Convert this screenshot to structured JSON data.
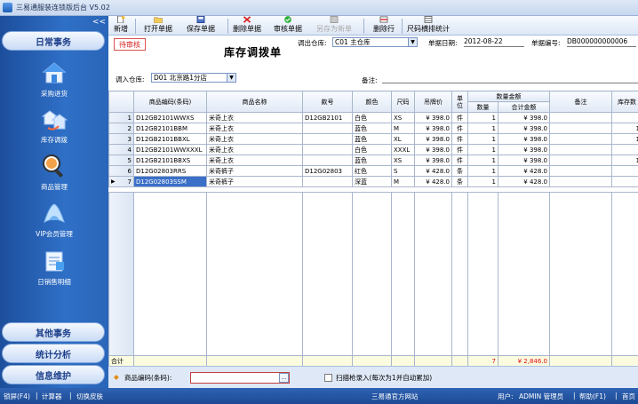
{
  "window": {
    "title": "三易通服装连锁版后台 V5.02"
  },
  "sidebar": {
    "sections": {
      "daily": "日常事务",
      "other": "其他事务",
      "stats": "统计分析",
      "info": "信息维护"
    },
    "collapse": "<<",
    "items": [
      {
        "label": "采购进货",
        "icon": "house-icon"
      },
      {
        "label": "库存调拨",
        "icon": "transfer-house-icon"
      },
      {
        "label": "商品管理",
        "icon": "magnifier-icon"
      },
      {
        "label": "VIP会员管理",
        "icon": "member-icon"
      },
      {
        "label": "日销售明细",
        "icon": "report-icon"
      }
    ]
  },
  "toolbar": {
    "new": "新增",
    "open": "打开单据",
    "save": "保存单据",
    "delete": "删除单据",
    "approve": "审核单据",
    "save_as_new": "另存为新单",
    "delete_row": "删除行",
    "size_stats": "尺码横排统计"
  },
  "form": {
    "status_stamp": "待审核",
    "title": "库存调拨单",
    "out_label": "调出仓库:",
    "out_value": "C01 主仓库",
    "date_label": "单据日期:",
    "date_value": "2012-08-22",
    "no_label": "单据编号:",
    "no_value": "DB000000000006",
    "in_label": "调入仓库:",
    "in_value": "D01 北京路1分店",
    "note_label": "备注:",
    "note_value": ""
  },
  "grid": {
    "headers": {
      "code": "商品编码(条码)",
      "name": "商品名称",
      "style": "款号",
      "color": "颜色",
      "size": "尺码",
      "price": "吊牌价",
      "unit": "单位",
      "qty_amount": "数量金额",
      "qty": "数量",
      "total": "合计金额",
      "note": "备注",
      "stock": "库存数"
    },
    "rows": [
      {
        "no": "1",
        "code": "D12GB2101WWXS",
        "name": "米奇上衣",
        "style": "D12GB2101",
        "color": "白色",
        "size": "XS",
        "price": "¥ 398.0",
        "unit": "件",
        "qty": "1",
        "total": "¥ 398.0",
        "note": "",
        "stock": ""
      },
      {
        "no": "2",
        "code": "D12GB2101BBM",
        "name": "米奇上衣",
        "style": "",
        "color": "蓝色",
        "size": "M",
        "price": "¥ 398.0",
        "unit": "件",
        "qty": "1",
        "total": "¥ 398.0",
        "note": "",
        "stock": "1"
      },
      {
        "no": "3",
        "code": "D12GB2101BBXL",
        "name": "米奇上衣",
        "style": "",
        "color": "蓝色",
        "size": "XL",
        "price": "¥ 398.0",
        "unit": "件",
        "qty": "1",
        "total": "¥ 398.0",
        "note": "",
        "stock": "1"
      },
      {
        "no": "4",
        "code": "D12GB2101WWXXXL",
        "name": "米奇上衣",
        "style": "",
        "color": "白色",
        "size": "XXXL",
        "price": "¥ 398.0",
        "unit": "件",
        "qty": "1",
        "total": "¥ 398.0",
        "note": "",
        "stock": ""
      },
      {
        "no": "5",
        "code": "D12GB2101BBXS",
        "name": "米奇上衣",
        "style": "",
        "color": "蓝色",
        "size": "XS",
        "price": "¥ 398.0",
        "unit": "件",
        "qty": "1",
        "total": "¥ 398.0",
        "note": "",
        "stock": "1"
      },
      {
        "no": "6",
        "code": "D12G02803RRS",
        "name": "米奇裤子",
        "style": "D12G02803",
        "color": "红色",
        "size": "S",
        "price": "¥ 428.0",
        "unit": "条",
        "qty": "1",
        "total": "¥ 428.0",
        "note": "",
        "stock": ""
      },
      {
        "no": "7",
        "code": "D12G02803SSM",
        "name": "米奇裤子",
        "style": "",
        "color": "深蓝",
        "size": "M",
        "price": "¥ 428.0",
        "unit": "条",
        "qty": "1",
        "total": "¥ 428.0",
        "note": "",
        "stock": ""
      }
    ],
    "sum_label": "合计",
    "sum_qty": "7",
    "sum_total": "¥ 2,846.0"
  },
  "input_bar": {
    "label": "商品编码(条码):",
    "value": "",
    "scan_label": "扫描枪录入(每次为1并自动累加)"
  },
  "status": {
    "lock": "锁屏(F4)",
    "calc": "计算器",
    "skin": "切换皮肤",
    "site": "三易通官方网站",
    "user_label": "用户:",
    "user_value": "ADMIN 管理员",
    "help": "帮助(F1)",
    "home": "首页"
  },
  "colors": {
    "sidebar": "#2f70c7",
    "selected": "#3b6fc8",
    "red": "#e01010"
  }
}
